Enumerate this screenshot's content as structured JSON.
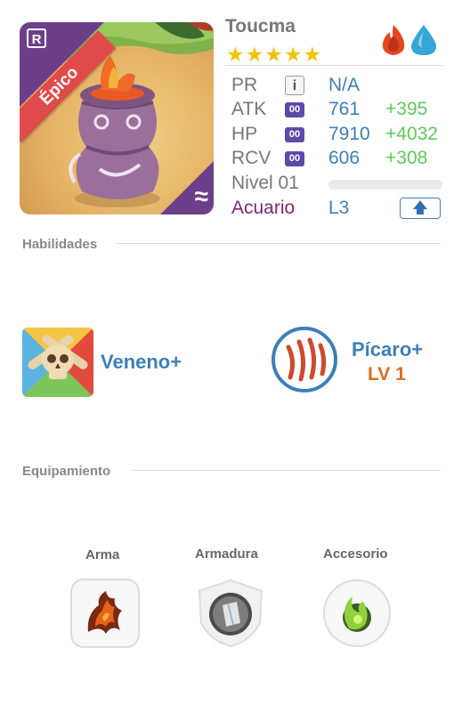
{
  "hero": {
    "name": "Toucma",
    "rarity": "Épico",
    "stars": "★★★★★",
    "tier_badge": "R",
    "element_icons": [
      "fire-icon",
      "water-icon"
    ]
  },
  "stats": {
    "pr": {
      "label": "PR",
      "value": "N/A"
    },
    "atk": {
      "label": "ATK",
      "value": "761",
      "bonus": "+395"
    },
    "hp": {
      "label": "HP",
      "value": "7910",
      "bonus": "+4032"
    },
    "rcv": {
      "label": "RCV",
      "value": "606",
      "bonus": "+308"
    },
    "level": {
      "label": "Nivel 01"
    },
    "sign": {
      "label": "Acuario",
      "value": "L3"
    },
    "stat_icon_text": "00",
    "info_icon_text": "i",
    "upgrade_arrow": "🡅"
  },
  "skills": {
    "title": "Habilidades",
    "left": {
      "name": "Veneno+",
      "icon": "skull-icon"
    },
    "right": {
      "name": "Pícaro+",
      "level": "LV 1",
      "icon": "claw-icon"
    }
  },
  "equipment": {
    "title": "Equipamiento",
    "slots": [
      {
        "label": "Arma",
        "icon": "weapon-icon"
      },
      {
        "label": "Armadura",
        "icon": "armor-icon"
      },
      {
        "label": "Accesorio",
        "icon": "accessory-icon"
      }
    ]
  },
  "colors": {
    "accent_blue": "#3d7fb8",
    "bonus_green": "#5ec95b",
    "rarity_purple": "#6d3f8a",
    "ribbon_red": "#e04a4a",
    "star_gold": "#f2c20c",
    "level_orange": "#e06a1f"
  }
}
